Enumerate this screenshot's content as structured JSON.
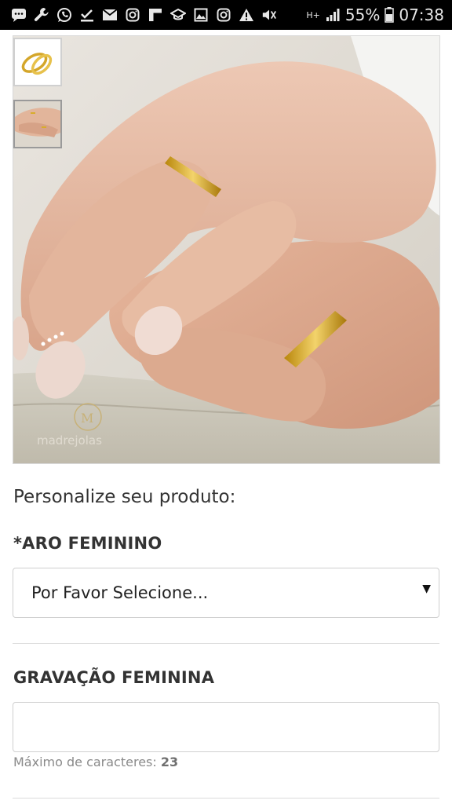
{
  "status_bar": {
    "icons": [
      "message-icon",
      "wrench-icon",
      "whatsapp-icon",
      "download-done-icon",
      "mail-icon",
      "instagram-icon",
      "flipboard-icon",
      "graduation-cap-icon",
      "image-icon",
      "instagram-icon",
      "warning-icon",
      "mute-icon",
      "network-icon",
      "signal-icon",
      "battery-icon"
    ],
    "network": "H+",
    "battery": "55%",
    "time": "07:38"
  },
  "gallery": {
    "watermark": "madrejolas",
    "thumbnails": [
      "rings-product-thumb",
      "rings-on-hands-thumb"
    ],
    "selected_thumbnail": 1
  },
  "product_options": {
    "title": "Personalize seu produto:",
    "aro_feminino": {
      "label": "*ARO FEMININO",
      "selected": "Por Favor Selecione..."
    },
    "gravacao_feminina": {
      "label": "GRAVAÇÃO FEMININA",
      "value": "",
      "hint_prefix": "Máximo de caracteres:",
      "hint_max": "23"
    }
  }
}
